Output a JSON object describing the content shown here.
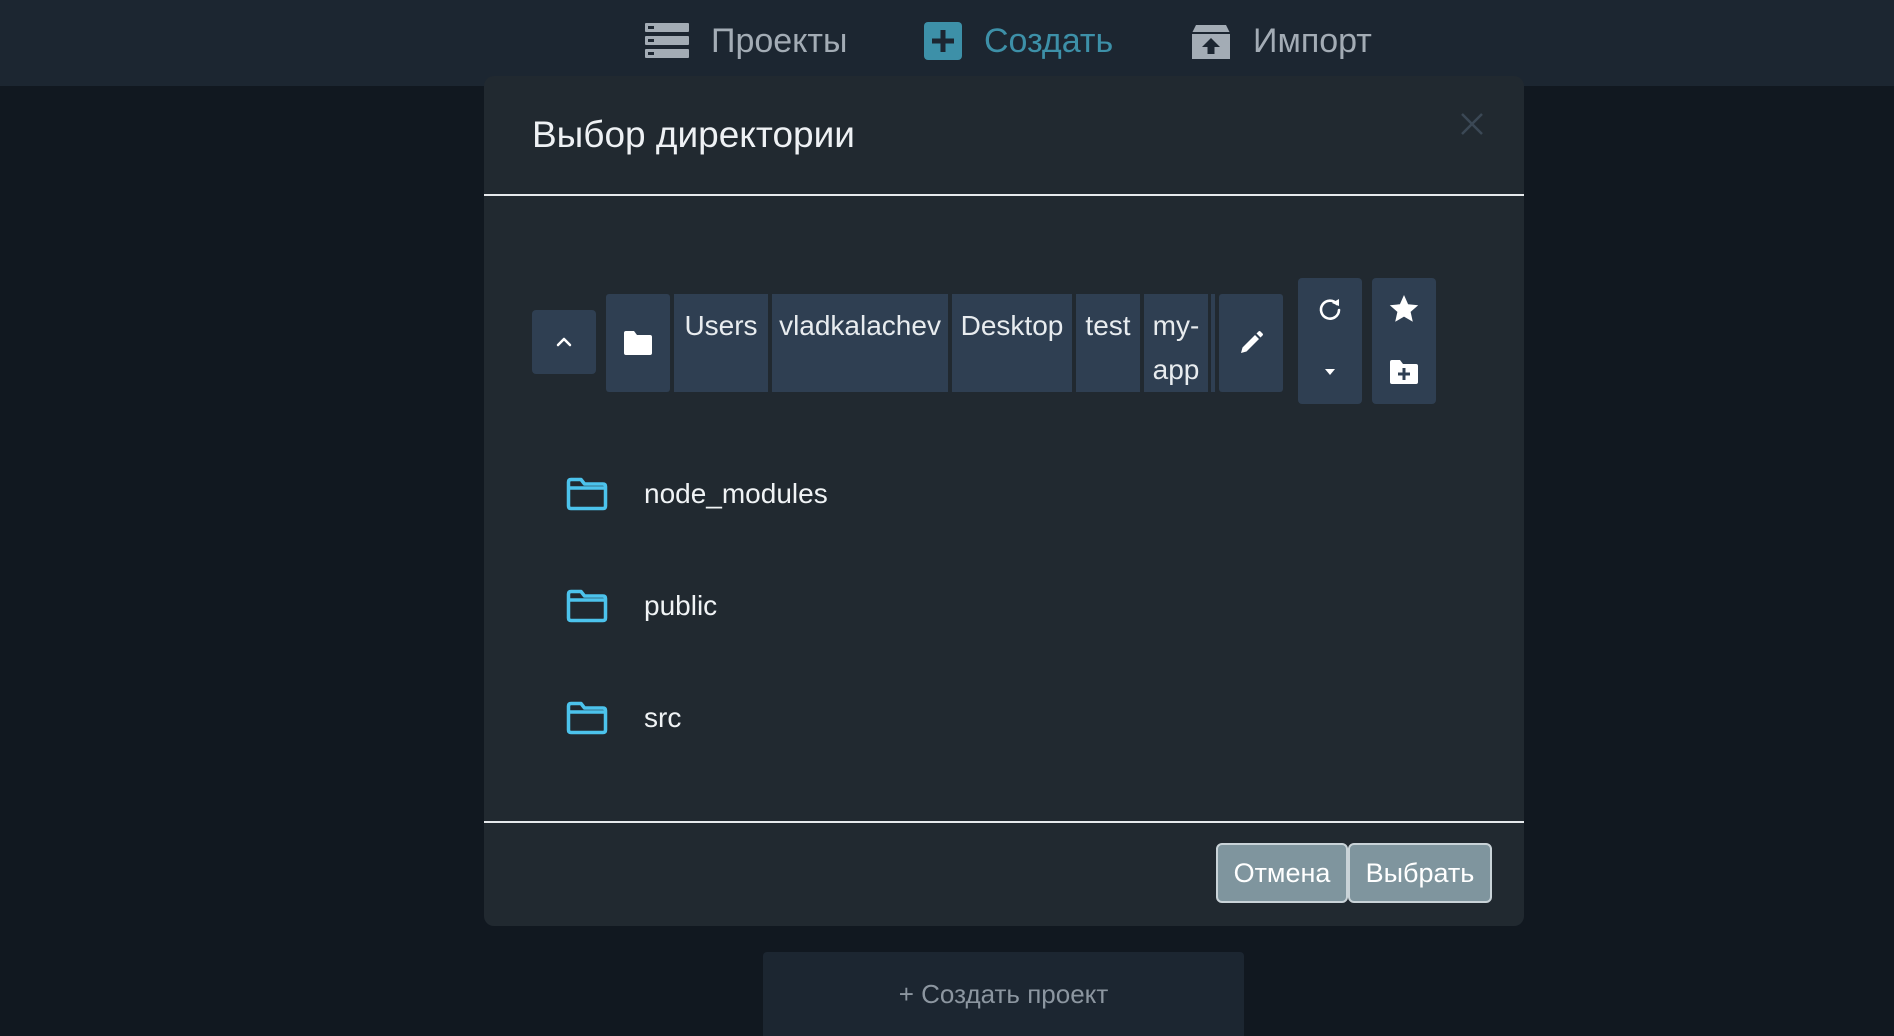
{
  "nav": {
    "projects": "Проекты",
    "create": "Создать",
    "import": "Импорт",
    "active": "create",
    "active_color": "#3d90a8"
  },
  "dialog": {
    "title": "Выбор директории",
    "path_segments": [
      "Users",
      "vladkalachev",
      "Desktop",
      "test",
      "my-app"
    ],
    "folders": [
      "node_modules",
      "public",
      "src"
    ],
    "folder_icon_color": "#4cc3ec",
    "cancel_label": "Отмена",
    "select_label": "Выбрать"
  },
  "background": {
    "create_project_label": "+ Создать проект"
  }
}
